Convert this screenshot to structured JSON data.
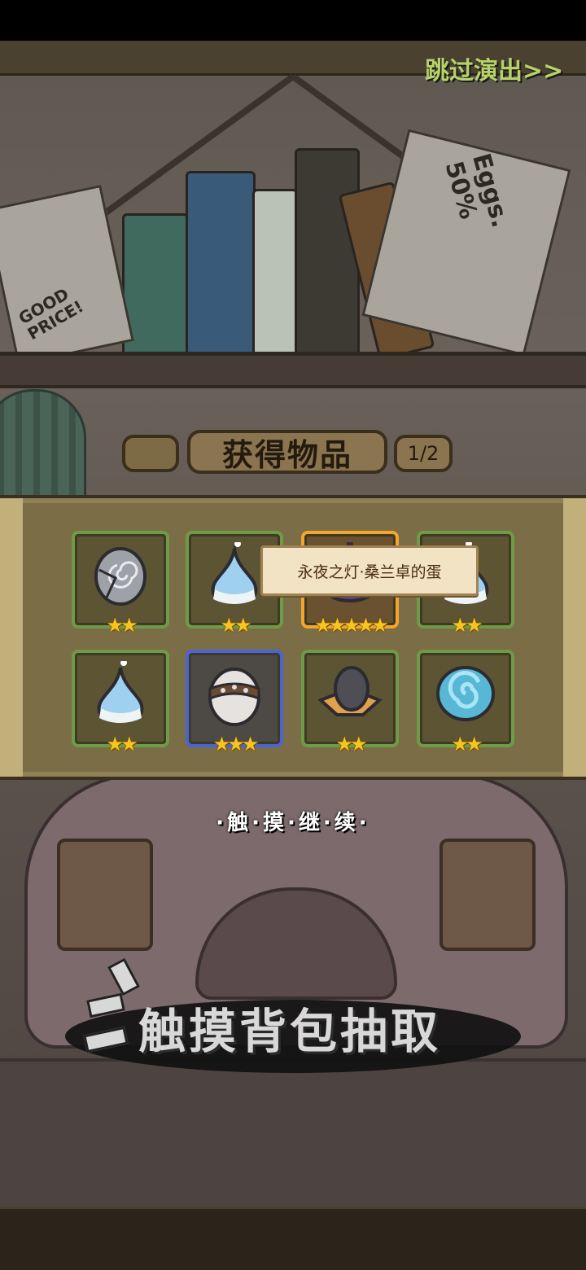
{
  "header": {
    "skip_label": "跳过演出>>"
  },
  "reward_panel": {
    "title": "获得物品",
    "page_indicator": "1/2",
    "tooltip": "永夜之灯·桑兰卓的蛋",
    "items": [
      {
        "icon": "stitched-spiral-egg-icon",
        "stars": 2,
        "frame": "green"
      },
      {
        "icon": "blue-drop-egg-icon",
        "stars": 2,
        "frame": "green"
      },
      {
        "icon": "purple-lamp-egg-icon",
        "stars": 5,
        "frame": "gold"
      },
      {
        "icon": "blue-drop-egg-icon",
        "stars": 2,
        "frame": "green"
      },
      {
        "icon": "blue-drop-egg-icon",
        "stars": 2,
        "frame": "green"
      },
      {
        "icon": "spiked-collar-egg-icon",
        "stars": 3,
        "frame": "blue"
      },
      {
        "icon": "dark-egg-in-leaf-icon",
        "stars": 2,
        "frame": "green"
      },
      {
        "icon": "shell-spiral-egg-icon",
        "stars": 2,
        "frame": "green"
      }
    ]
  },
  "continue_hint": "·触·摸·继·续·",
  "touch_prompt": "触摸背包抽取",
  "background": {
    "poster_left_text": "GOOD PRICE!",
    "poster_right_text": "Eggs. 50%"
  },
  "colors": {
    "frame_green": "#6f9a48",
    "frame_gold": "#f4a52b",
    "frame_blue": "#4b63d8",
    "star": "#f7c51f",
    "skip": "#b8d26a"
  }
}
